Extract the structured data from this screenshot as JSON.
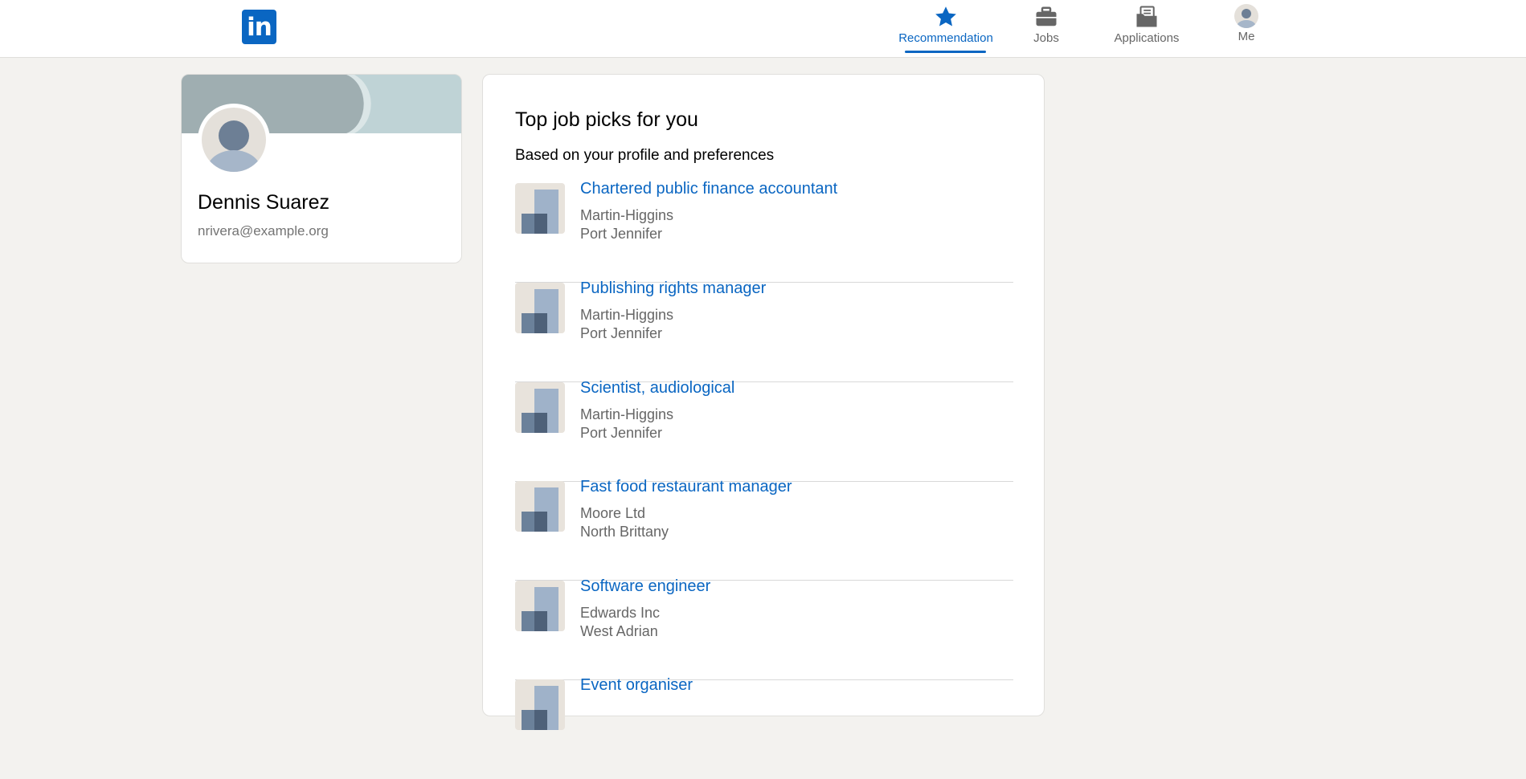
{
  "header": {
    "logo_text": "in",
    "nav": [
      {
        "label": "Recommendation",
        "icon": "star-icon"
      },
      {
        "label": "Jobs",
        "icon": "briefcase-icon"
      },
      {
        "label": "Applications",
        "icon": "folder-icon"
      },
      {
        "label": "Me",
        "icon": "avatar-icon"
      }
    ],
    "active": "Recommendation"
  },
  "profile": {
    "name": "Dennis Suarez",
    "email": "nrivera@example.org"
  },
  "recommendations": {
    "title": "Top job picks for you",
    "subtitle": "Based on your profile and preferences",
    "jobs": [
      {
        "title": "Chartered public finance accountant",
        "company": "Martin-Higgins",
        "location": "Port Jennifer"
      },
      {
        "title": "Publishing rights manager",
        "company": "Martin-Higgins",
        "location": "Port Jennifer"
      },
      {
        "title": "Scientist, audiological",
        "company": "Martin-Higgins",
        "location": "Port Jennifer"
      },
      {
        "title": "Fast food restaurant manager",
        "company": "Moore Ltd",
        "location": "North Brittany"
      },
      {
        "title": "Software engineer",
        "company": "Edwards Inc",
        "location": "West Adrian"
      },
      {
        "title": "Event organiser",
        "company": "",
        "location": ""
      }
    ]
  },
  "colors": {
    "brand": "#0a66c2",
    "background": "#f3f2ef",
    "muted_text": "#666666"
  }
}
